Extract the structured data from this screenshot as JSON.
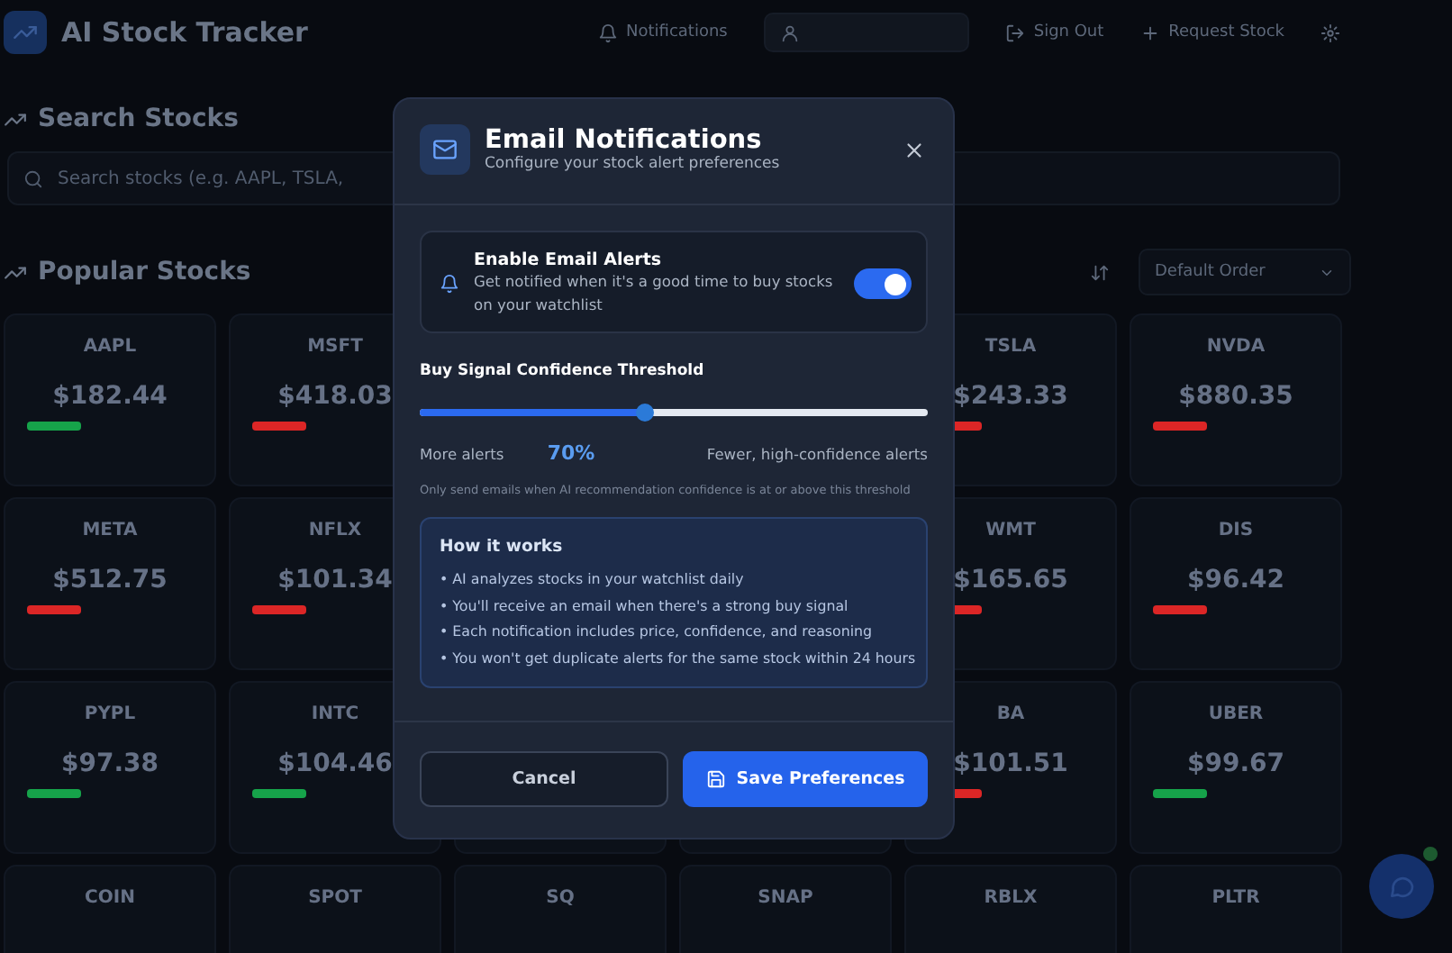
{
  "app": {
    "title": "AI Stock Tracker",
    "nav": [
      {
        "kind": "notifications",
        "label": "Notifications"
      },
      {
        "kind": "account"
      },
      {
        "kind": "signout",
        "label": "Sign Out"
      },
      {
        "kind": "request",
        "label": "Request Stock"
      }
    ]
  },
  "search": {
    "heading": "Search Stocks",
    "placeholder": "Search stocks (e.g. AAPL, TSLA,"
  },
  "popular": {
    "heading": "Popular Stocks",
    "sort": "Default Order",
    "rows": [
      {
        "left": [
          {
            "ticker": "AAPL",
            "price": "$182.44",
            "color": "#16a34a"
          },
          {
            "ticker": "MSFT",
            "price": "$418.03",
            "color": "#dc2626"
          }
        ],
        "right": [
          {
            "ticker": "TSLA",
            "price": "$243.33",
            "color": "#dc2626"
          },
          {
            "ticker": "NVDA",
            "price": "$880.35",
            "color": "#dc2626"
          }
        ]
      },
      {
        "left": [
          {
            "ticker": "META",
            "price": "$512.75",
            "color": "#dc2626"
          },
          {
            "ticker": "NFLX",
            "price": "$101.34",
            "color": "#dc2626"
          }
        ],
        "right": [
          {
            "ticker": "WMT",
            "price": "$165.65",
            "color": "#dc2626"
          },
          {
            "ticker": "DIS",
            "price": "$96.42",
            "color": "#dc2626"
          }
        ]
      },
      {
        "left": [
          {
            "ticker": "PYPL",
            "price": "$97.38",
            "color": "#16a34a"
          },
          {
            "ticker": "INTC",
            "price": "$104.46",
            "color": "#16a34a"
          }
        ],
        "right": [
          {
            "ticker": "BA",
            "price": "$101.51",
            "color": "#dc2626"
          },
          {
            "ticker": "UBER",
            "price": "$99.67",
            "color": "#16a34a"
          }
        ]
      },
      {
        "left": [
          {
            "ticker": "COIN"
          },
          {
            "ticker": "SPOT"
          },
          {
            "ticker": "SQ"
          },
          {
            "ticker": "SNAP"
          },
          {
            "ticker": "RBLX"
          },
          {
            "ticker": "PLTR"
          }
        ],
        "right": []
      }
    ]
  },
  "modal": {
    "title": "Email Notifications",
    "subtitle": "Configure your stock alert preferences",
    "toggle": {
      "label": "Enable Email Alerts",
      "description": "Get notified when it's a good time to buy stocks on your watchlist",
      "on": true
    },
    "threshold": {
      "label": "Buy Signal Confidence Threshold",
      "level": 0.445,
      "left_label": "More alerts",
      "value": "70%",
      "right_label": "Fewer, high-confidence alerts",
      "hint": "Only send emails when AI recommendation confidence is at or above this threshold"
    },
    "info": {
      "title": "How it works",
      "items": [
        "• AI analyzes stocks in your watchlist daily",
        "• You'll receive an email when there's a strong buy signal",
        "• Each notification includes price, confidence, and reasoning",
        "• You won't get duplicate alerts for the same stock within 24 hours"
      ]
    },
    "buttons": [
      {
        "kind": "cancel",
        "label": "Cancel"
      },
      {
        "kind": "save",
        "label": "Save Preferences"
      }
    ]
  }
}
